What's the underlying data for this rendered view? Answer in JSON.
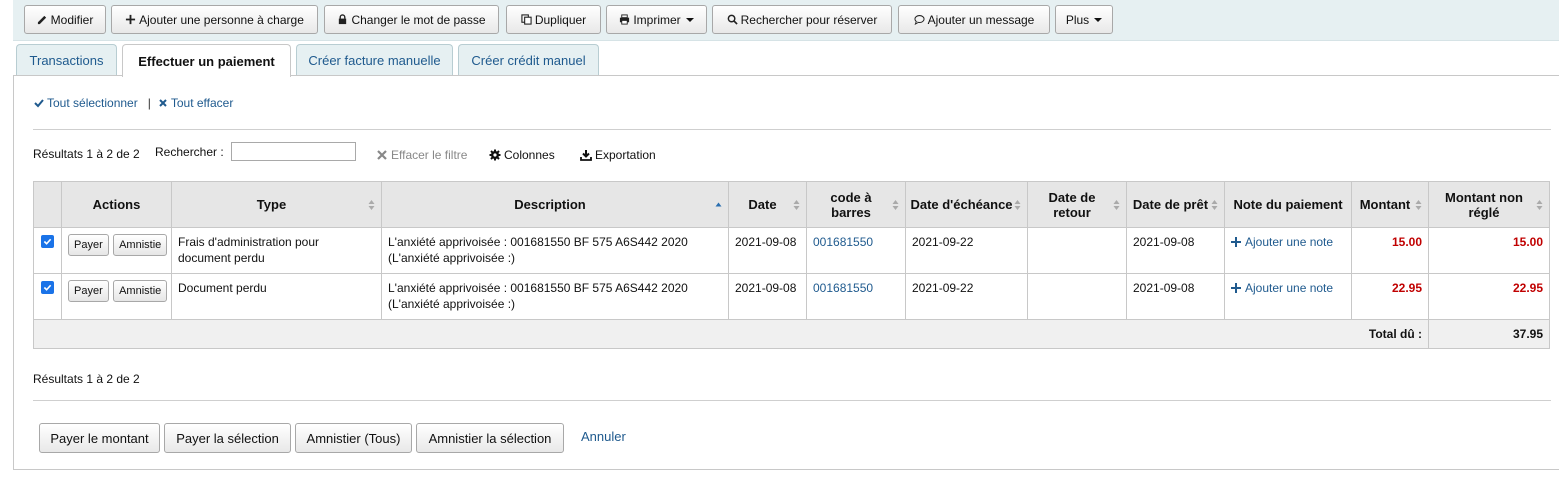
{
  "toolbar": {
    "buttons": [
      {
        "label": "Modifier",
        "icon": "pencil-icon"
      },
      {
        "label": "Ajouter une personne à charge",
        "icon": "plus-icon"
      },
      {
        "label": "Changer le mot de passe",
        "icon": "lock-icon"
      },
      {
        "label": "Dupliquer",
        "icon": "copy-icon"
      },
      {
        "label": "Imprimer",
        "icon": "print-icon"
      },
      {
        "label": "Rechercher pour réserver",
        "icon": "search-icon"
      },
      {
        "label": "Ajouter un message",
        "icon": "comment-icon"
      },
      {
        "label": "Plus"
      }
    ]
  },
  "tabs": [
    {
      "label": "Transactions",
      "active": false
    },
    {
      "label": "Effectuer un paiement",
      "active": true
    },
    {
      "label": "Créer facture manuelle",
      "active": false
    },
    {
      "label": "Créer crédit manuel",
      "active": false
    }
  ],
  "selection": {
    "select_all": "Tout sélectionner",
    "separator": "|",
    "clear_all": "Tout effacer"
  },
  "filter": {
    "results_top": "Résultats 1 à 2 de 2",
    "search_label": "Rechercher :",
    "search_value": "",
    "clear_filter": "Effacer le filtre",
    "columns": "Colonnes",
    "export": "Exportation"
  },
  "table": {
    "headers": {
      "actions": "Actions",
      "type": "Type",
      "description": "Description",
      "date": "Date",
      "barcode": "code à barres",
      "due_date": "Date d'échéance",
      "return_date": "Date de retour",
      "loan_date": "Date de prêt",
      "note": "Note du paiement",
      "amount": "Montant",
      "outstanding": "Montant non réglé"
    },
    "row_buttons": {
      "pay": "Payer",
      "writeoff": "Amnistie"
    },
    "rows": [
      {
        "checked": true,
        "type": "Frais d'administration pour document perdu",
        "description": "L'anxiété apprivoisée : 001681550 BF 575 A6S442 2020 (L'anxiété apprivoisée :)",
        "date": "2021-09-08",
        "barcode": "001681550",
        "due_date": "2021-09-22",
        "return_date": "",
        "loan_date": "2021-09-08",
        "note": "Ajouter une note",
        "amount": "15.00",
        "outstanding": "15.00"
      },
      {
        "checked": true,
        "type": "Document perdu",
        "description": "L'anxiété apprivoisée : 001681550 BF 575 A6S442 2020 (L'anxiété apprivoisée :)",
        "date": "2021-09-08",
        "barcode": "001681550",
        "due_date": "2021-09-22",
        "return_date": "",
        "loan_date": "2021-09-08",
        "note": "Ajouter une note",
        "amount": "22.95",
        "outstanding": "22.95"
      }
    ],
    "footer": {
      "label": "Total dû :",
      "value": "37.95"
    }
  },
  "results_bottom": "Résultats 1 à 2 de 2",
  "actions": {
    "pay_amount": "Payer le montant",
    "pay_selected": "Payer la sélection",
    "writeoff_all": "Amnistier (Tous)",
    "writeoff_selected": "Amnistier la sélection",
    "cancel": "Annuler"
  },
  "colors": {
    "link": "#1f5a8e",
    "amount": "#c00000",
    "tab_bg": "#e6f0f2",
    "checkbox": "#1a73e8"
  }
}
